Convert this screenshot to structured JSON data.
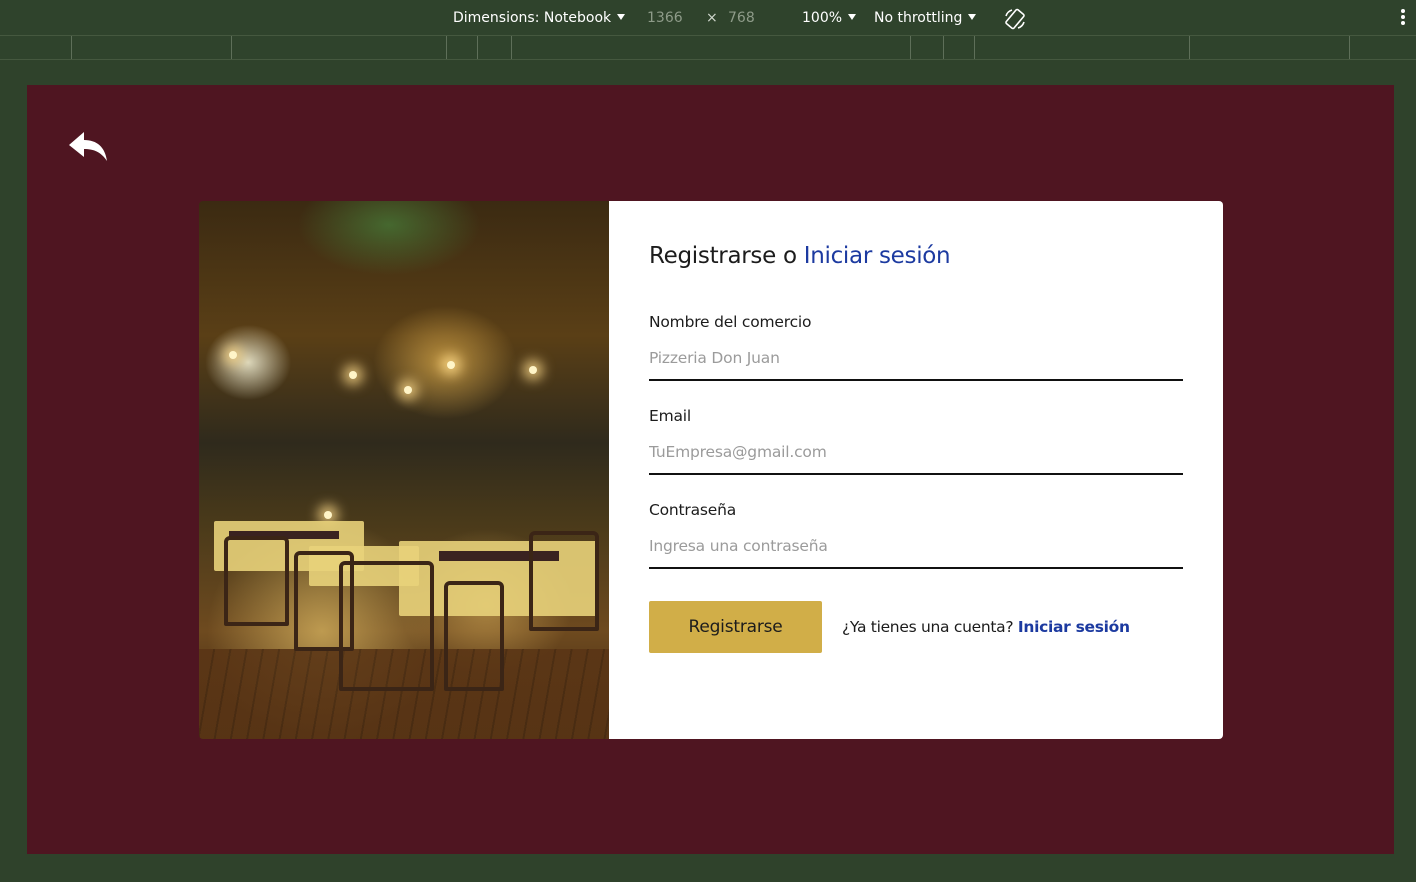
{
  "devtools": {
    "dimensions_label": "Dimensions: Notebook",
    "width": "1366",
    "times": "×",
    "height": "768",
    "zoom": "100%",
    "throttling": "No throttling",
    "icons": [
      "chevron-down-icon",
      "rotate-icon",
      "more-icon"
    ]
  },
  "page": {
    "back_icon": "back-arrow-icon",
    "title_prefix": "Registrarse o ",
    "title_link": "Iniciar sesión",
    "fields": [
      {
        "label": "Nombre del comercio",
        "placeholder": "Pizzeria Don Juan"
      },
      {
        "label": "Email",
        "placeholder": "TuEmpresa@gmail.com"
      },
      {
        "label": "Contraseña",
        "placeholder": "Ingresa una contraseña"
      }
    ],
    "submit_label": "Registrarse",
    "account_question": "¿Ya tienes una cuenta? ",
    "account_link": "Iniciar sesión",
    "image_alt": "restaurant-photo"
  },
  "colors": {
    "viewport_bg": "#4f1521",
    "outer_bg": "#2f422b",
    "button": "#d1ae48",
    "link": "#1c3aa0"
  }
}
